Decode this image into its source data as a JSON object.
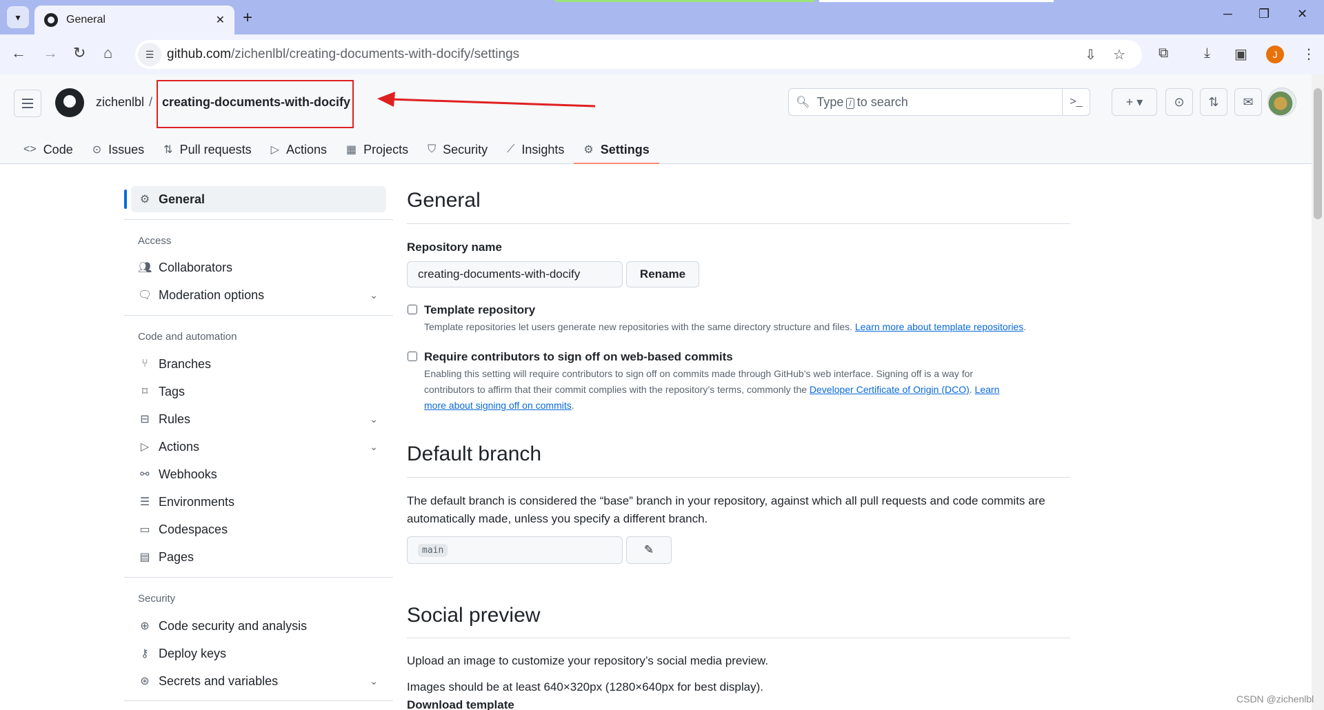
{
  "browser": {
    "tab_title": "General",
    "tab_close": "✕",
    "new_tab": "+",
    "url_host": "github.com",
    "url_path": "/zichenlbl/creating-documents-with-docify/settings",
    "profile_initial": "J"
  },
  "header": {
    "owner": "zichenlbl",
    "separator": "/",
    "repo": "creating-documents-with-docify",
    "search_prefix": "Type",
    "search_key": "/",
    "search_suffix": "to search",
    "create_label": "+ ▾"
  },
  "repo_nav": [
    {
      "label": "Code",
      "icon": "code-icon"
    },
    {
      "label": "Issues",
      "icon": "issue-icon"
    },
    {
      "label": "Pull requests",
      "icon": "pull-request-icon"
    },
    {
      "label": "Actions",
      "icon": "play-icon"
    },
    {
      "label": "Projects",
      "icon": "table-icon"
    },
    {
      "label": "Security",
      "icon": "shield-icon"
    },
    {
      "label": "Insights",
      "icon": "graph-icon"
    },
    {
      "label": "Settings",
      "icon": "gear-icon",
      "active": true
    }
  ],
  "sidebar": {
    "general": "General",
    "access_heading": "Access",
    "collaborators": "Collaborators",
    "moderation": "Moderation options",
    "code_heading": "Code and automation",
    "branches": "Branches",
    "tags": "Tags",
    "rules": "Rules",
    "actions": "Actions",
    "webhooks": "Webhooks",
    "environments": "Environments",
    "codespaces": "Codespaces",
    "pages": "Pages",
    "security_heading": "Security",
    "code_security": "Code security and analysis",
    "deploy_keys": "Deploy keys",
    "secrets": "Secrets and variables"
  },
  "general": {
    "title": "General",
    "repo_name_label": "Repository name",
    "repo_name_value": "creating-documents-with-docify",
    "rename_button": "Rename",
    "template_label": "Template repository",
    "template_note": "Template repositories let users generate new repositories with the same directory structure and files.",
    "template_link": "Learn more about template repositories",
    "signoff_label": "Require contributors to sign off on web-based commits",
    "signoff_note_1": "Enabling this setting will require contributors to sign off on commits made through GitHub’s web interface. Signing off is a way for",
    "signoff_note_2": "contributors to affirm that their commit complies with the repository’s terms, commonly the",
    "signoff_link_dco": "Developer Certificate of Origin (DCO)",
    "signoff_link_learn_1": "Learn",
    "signoff_link_learn_2": "more about signing off on commits"
  },
  "default_branch": {
    "title": "Default branch",
    "description": "The default branch is considered the “base” branch in your repository, against which all pull requests and code commits are automatically made, unless you specify a different branch.",
    "branch": "main"
  },
  "social_preview": {
    "title": "Social preview",
    "line1": "Upload an image to customize your repository’s social media preview.",
    "line2": "Images should be at least 640×320px (1280×640px for best display).",
    "download_link": "Download template"
  },
  "watermark": "CSDN @zichenlbl"
}
